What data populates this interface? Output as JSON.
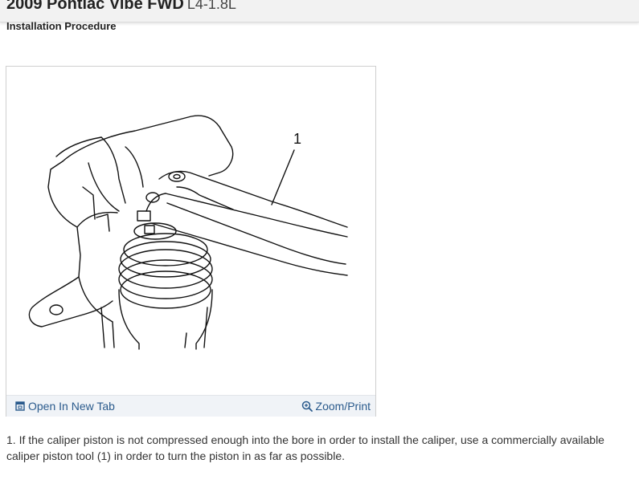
{
  "header": {
    "title": "2009 Pontiac Vibe FWD",
    "engine": "L4-1.8L"
  },
  "section": {
    "title": "Installation Procedure"
  },
  "figure": {
    "callout": "1",
    "open_tab_label": "Open In New Tab",
    "zoom_label": "Zoom/Print",
    "open_tab_icon": "open-in-new-tab-icon",
    "zoom_icon": "zoom-in-icon",
    "link_color": "#2a5a8c"
  },
  "steps": [
    {
      "text": "1. If the caliper piston is not compressed enough into the bore in order to install the caliper, use a commercially available caliper piston tool (1) in order to turn the piston in as far as possible."
    }
  ]
}
